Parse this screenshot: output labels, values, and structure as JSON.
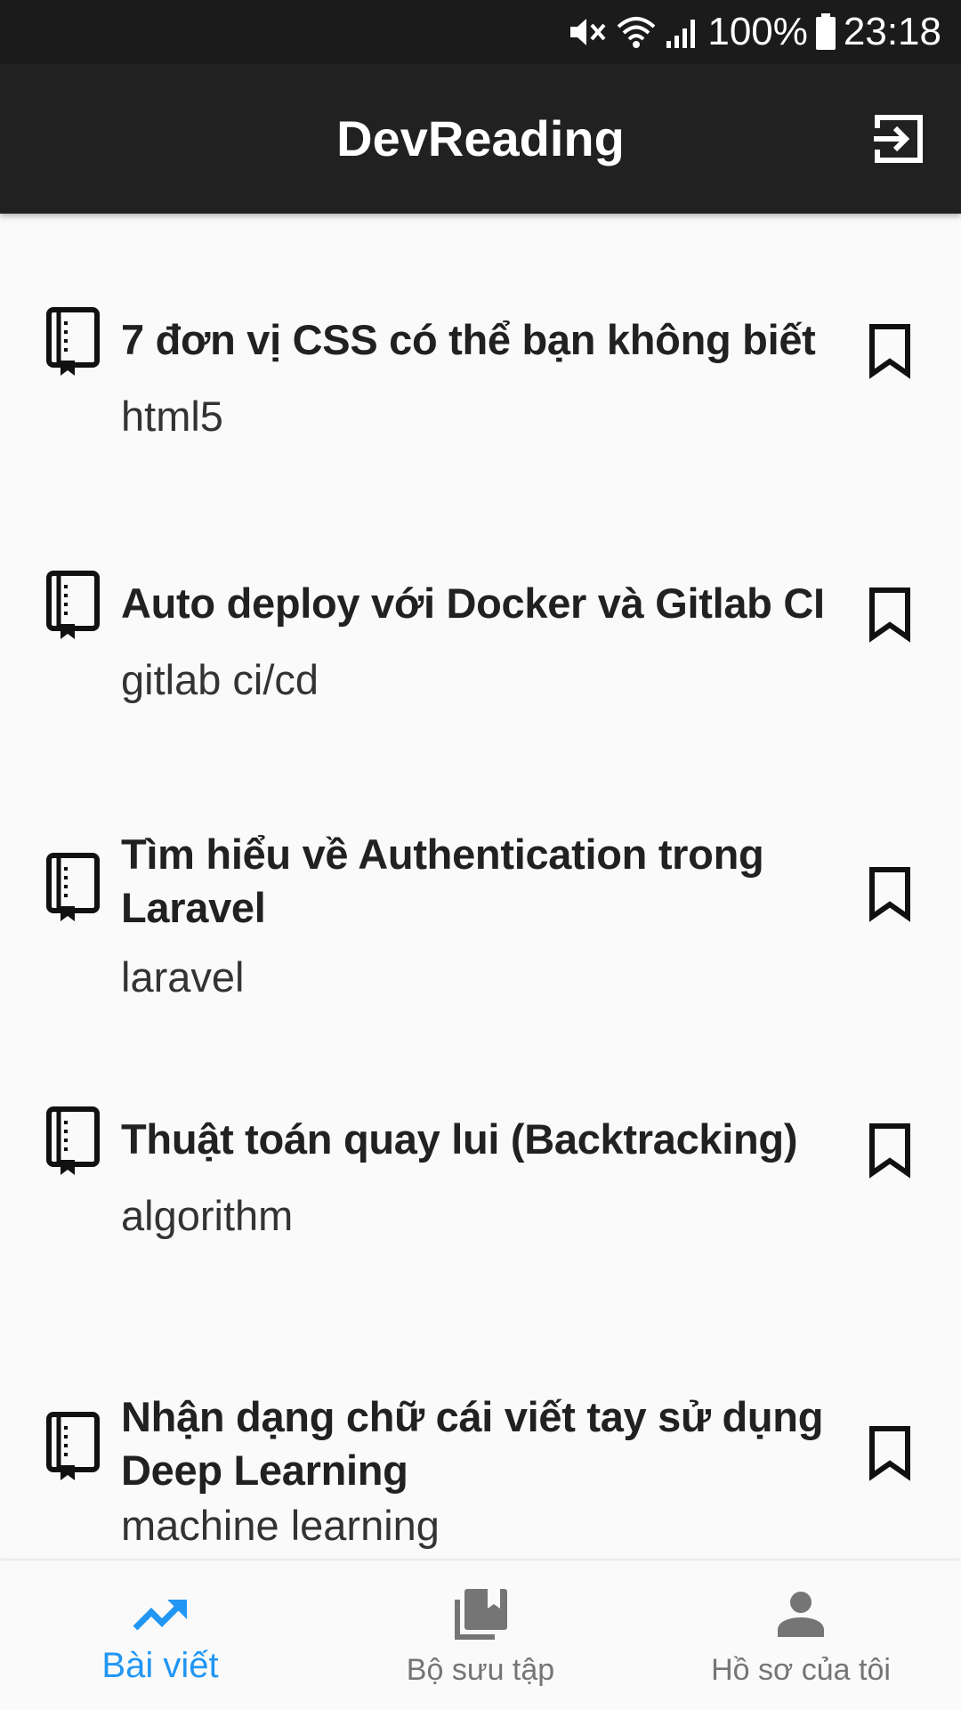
{
  "status_bar": {
    "battery": "100%",
    "time": "23:18",
    "icons": [
      "mute-icon",
      "wifi-icon",
      "signal-icon",
      "battery-icon"
    ]
  },
  "app_bar": {
    "title": "DevReading",
    "logout_icon": "logout-icon"
  },
  "articles": [
    {
      "title_lines": [
        "7 đơn vị CSS có thể bạn không biết",
        ""
      ],
      "tag": "html5"
    },
    {
      "title_lines": [
        "Auto deploy với Docker và Gitlab CI",
        ""
      ],
      "tag": "gitlab ci/cd"
    },
    {
      "title_lines": [
        "Tìm hiểu về Authentication trong",
        "Laravel"
      ],
      "tag": "laravel"
    },
    {
      "title_lines": [
        "Thuật toán quay lui (Backtracking)",
        ""
      ],
      "tag": "algorithm"
    },
    {
      "title_lines": [
        "Nhận dạng chữ cái viết tay sử dụng",
        "Deep Learning"
      ],
      "tag": "machine learning"
    }
  ],
  "bottom_nav": {
    "items": [
      {
        "label": "Bài viết",
        "icon": "trending-up-icon",
        "active": true
      },
      {
        "label": "Bộ sưu tập",
        "icon": "collections-icon",
        "active": false
      },
      {
        "label": "Hồ sơ của tôi",
        "icon": "person-icon",
        "active": false
      }
    ]
  },
  "colors": {
    "app_bar": "#212121",
    "status_bar": "#1b1b1b",
    "background": "#fafafa",
    "active": "#2196f3",
    "inactive": "#757575"
  }
}
